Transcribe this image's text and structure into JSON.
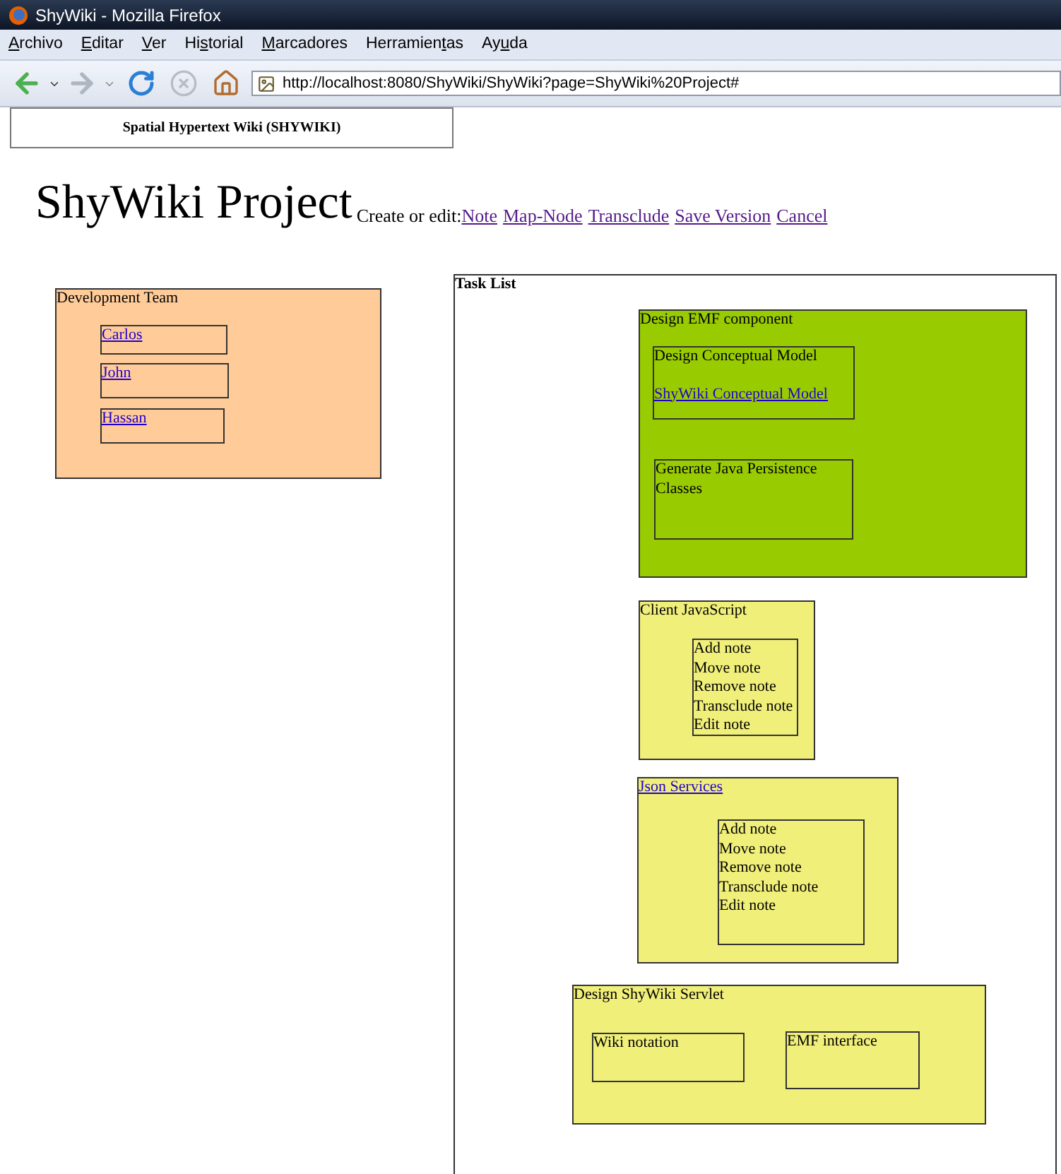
{
  "window": {
    "title": "ShyWiki - Mozilla Firefox"
  },
  "menu": [
    {
      "key": "A",
      "after": "rchivo"
    },
    {
      "key": "E",
      "after": "ditar"
    },
    {
      "key": "V",
      "after": "er"
    },
    {
      "before": "Hi",
      "key": "s",
      "after": "torial"
    },
    {
      "key": "M",
      "after": "arcadores"
    },
    {
      "before": "Herramien",
      "key": "t",
      "after": "as"
    },
    {
      "before": "Ay",
      "key": "u",
      "after": "da"
    }
  ],
  "address": {
    "value": "http://localhost:8080/ShyWiki/ShyWiki?page=ShyWiki%20Project#"
  },
  "site_header": "Spatial Hypertext Wiki (SHYWIKI)",
  "page_title": "ShyWiki Project",
  "edit_label": "Create or edit:",
  "edit_links": [
    "Note",
    "Map-Node",
    "Transclude",
    "Save Version",
    "Cancel"
  ],
  "notes": [
    {
      "color": "#ffcc99",
      "lines": [
        {
          "kind": "text",
          "text": "Development Team"
        }
      ],
      "children": [
        {
          "lines": [
            {
              "kind": "link",
              "text": "Carlos"
            }
          ]
        },
        {
          "lines": [
            {
              "kind": "link",
              "text": "John"
            }
          ]
        },
        {
          "lines": [
            {
              "kind": "link",
              "text": "Hassan"
            }
          ]
        }
      ]
    },
    {
      "color": "#ffffff",
      "lines": [
        {
          "kind": "heading",
          "text": "Task List"
        }
      ],
      "children": [
        {
          "color": "#99cc00",
          "lines": [
            {
              "kind": "text",
              "text": "Design EMF component"
            }
          ],
          "children": [
            {
              "lines": [
                {
                  "kind": "text",
                  "text": "Design Conceptual Model"
                },
                {
                  "kind": "link",
                  "text": "ShyWiki Conceptual Model"
                }
              ]
            },
            {
              "lines": [
                {
                  "kind": "text",
                  "text": "Generate Java Persistence Classes"
                }
              ]
            }
          ]
        },
        {
          "color": "#f0ef7a",
          "lines": [
            {
              "kind": "text",
              "text": "Client JavaScript"
            }
          ],
          "children": [
            {
              "lines": [
                {
                  "kind": "text",
                  "text": "Add note"
                },
                {
                  "kind": "text",
                  "text": "Move note"
                },
                {
                  "kind": "text",
                  "text": "Remove note"
                },
                {
                  "kind": "text",
                  "text": "Transclude note"
                },
                {
                  "kind": "text",
                  "text": "Edit note"
                }
              ]
            }
          ]
        },
        {
          "color": "#f0ef7a",
          "lines": [
            {
              "kind": "link",
              "text": "Json Services"
            }
          ],
          "children": [
            {
              "lines": [
                {
                  "kind": "text",
                  "text": "Add note"
                },
                {
                  "kind": "text",
                  "text": "Move note"
                },
                {
                  "kind": "text",
                  "text": "Remove note"
                },
                {
                  "kind": "text",
                  "text": "Transclude note"
                },
                {
                  "kind": "text",
                  "text": "Edit note"
                }
              ]
            }
          ]
        },
        {
          "color": "#f0ef7a",
          "lines": [
            {
              "kind": "text",
              "text": "Design ShyWiki Servlet"
            }
          ],
          "children": [
            {
              "lines": [
                {
                  "kind": "text",
                  "text": "Wiki notation"
                }
              ]
            },
            {
              "lines": [
                {
                  "kind": "text",
                  "text": "EMF interface"
                }
              ]
            }
          ]
        }
      ]
    }
  ]
}
